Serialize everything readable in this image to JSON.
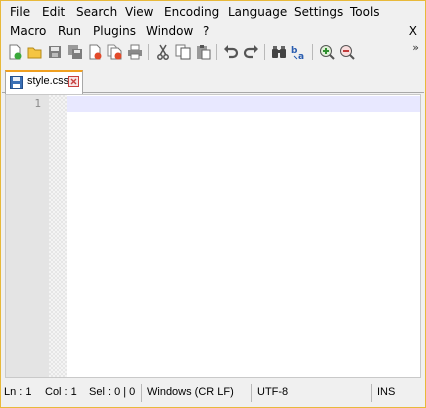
{
  "menu": {
    "row1": [
      "File",
      "Edit",
      "Search",
      "View",
      "Encoding",
      "Language",
      "Settings",
      "Tools"
    ],
    "row2": [
      "Macro",
      "Run",
      "Plugins",
      "Window",
      "?"
    ],
    "close_label": "X"
  },
  "toolbar": {
    "buttons": [
      "new-file",
      "open-file",
      "save",
      "save-all",
      "close",
      "close-all",
      "print",
      "cut",
      "copy",
      "paste",
      "undo",
      "redo",
      "find",
      "replace",
      "zoom-in",
      "zoom-out"
    ],
    "overflow_label": "»"
  },
  "tab": {
    "label": "style.css"
  },
  "editor": {
    "line_number": "1"
  },
  "statusbar": {
    "line": "Ln : 1",
    "col": "Col : 1",
    "sel": "Sel : 0 | 0",
    "eol": "Windows (CR LF)",
    "encoding": "UTF-8",
    "mode": "INS"
  },
  "colors": {
    "accent": "#f0a020",
    "current_line": "#e8e8ff",
    "gutter": "#e4e4e4",
    "window_border": "#e8b93a"
  }
}
